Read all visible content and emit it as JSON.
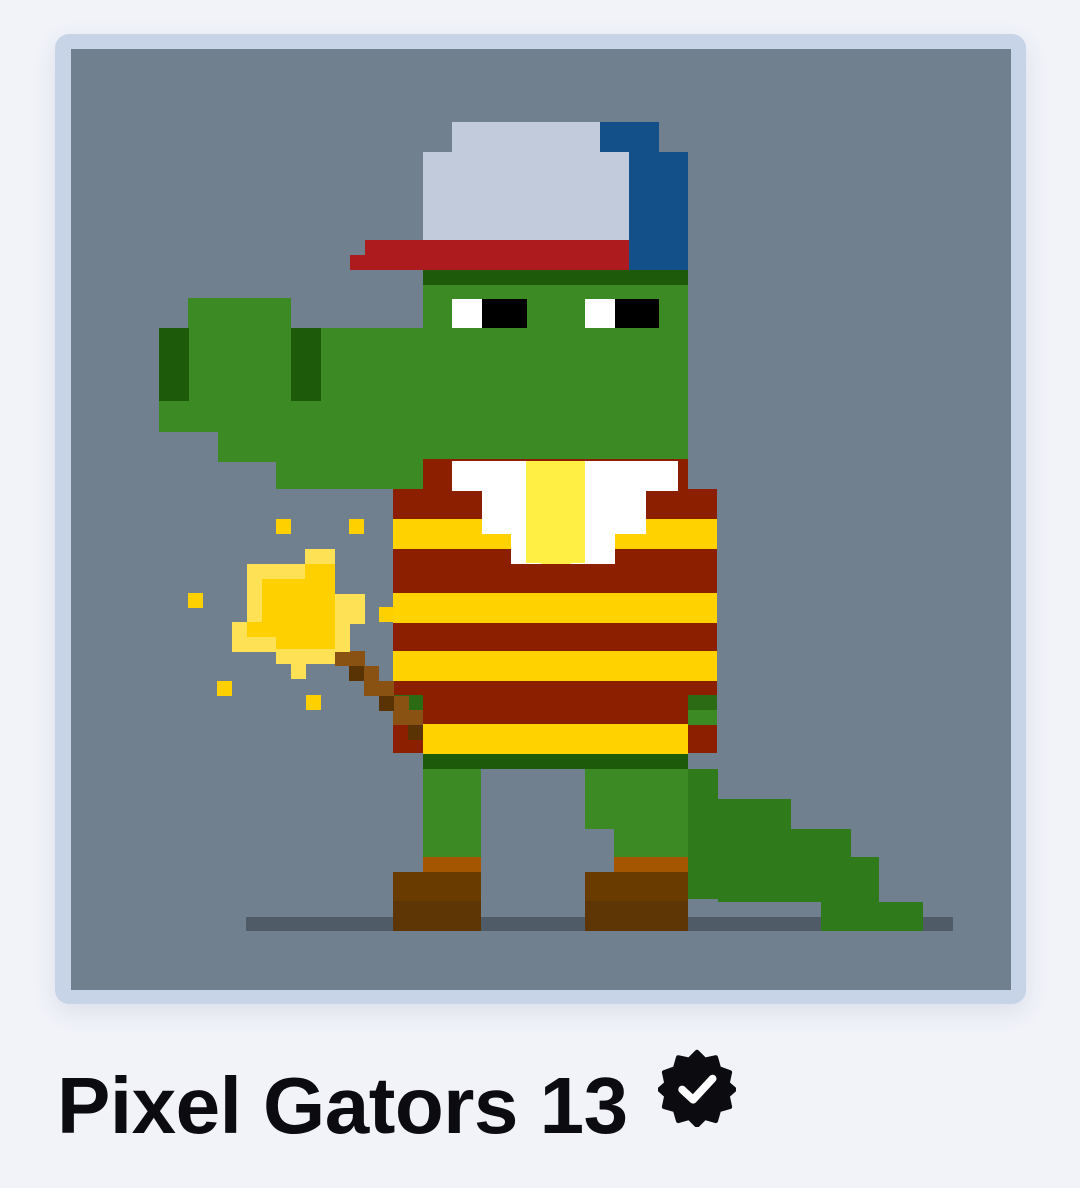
{
  "nft": {
    "title": "Pixel Gators 13",
    "verified": true,
    "verified_icon": "verified-badge-icon",
    "art_icon": "pixel-gator-artwork",
    "colors": {
      "background": "#f1f3f9",
      "card_border": "#c7d4e8",
      "art_background": "#70808f",
      "gator_green": "#3b8a23",
      "dark_green": "#1d5a0a",
      "cap_gray": "#c1cbdb",
      "cap_blue": "#13508a",
      "cap_brim": "#ad1b1f",
      "shirt_red": "#8c1f00",
      "shirt_yellow": "#ffd200",
      "boot_brown": "#6a3b00",
      "title_text": "#0c0c10"
    }
  }
}
